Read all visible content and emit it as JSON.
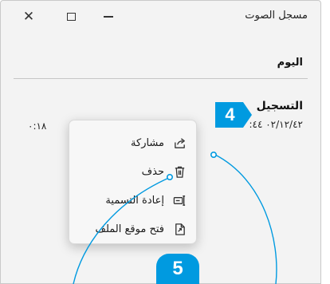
{
  "window": {
    "title": "مسجل الصوت",
    "controls": {
      "close": "close-icon",
      "maximize": "maximize-icon",
      "minimize": "minimize-icon"
    }
  },
  "section": {
    "header": "اليوم"
  },
  "recording": {
    "name": "التسجيل",
    "date": "٠٢/١٢/٤٢ ٤٤:",
    "duration": "٠:١٨"
  },
  "context_menu": {
    "items": [
      {
        "label": "مشاركة",
        "icon": "share-icon"
      },
      {
        "label": "حذف",
        "icon": "delete-icon"
      },
      {
        "label": "إعادة التسمية",
        "icon": "rename-icon"
      },
      {
        "label": "فتح موقع الملف",
        "icon": "open-file-location-icon"
      }
    ]
  },
  "callouts": {
    "badge_4": "4",
    "badge_5": "5",
    "color": "#009ae0"
  }
}
